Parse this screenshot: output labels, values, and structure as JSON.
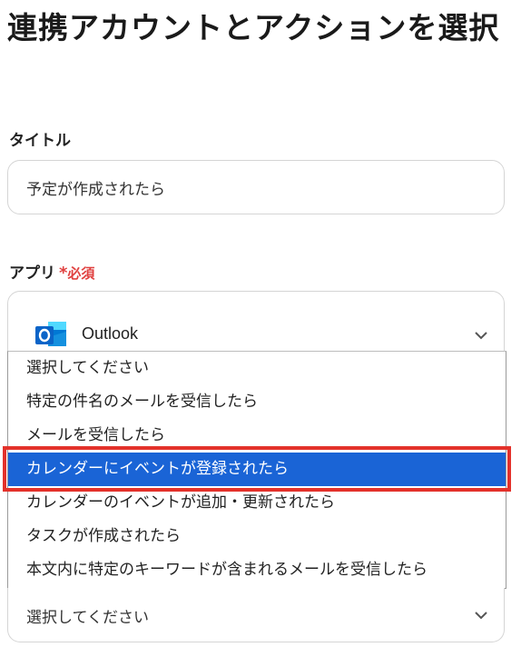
{
  "page": {
    "title": "連携アカウントとアクションを選択"
  },
  "title_field": {
    "label": "タイトル",
    "value": "予定が作成されたら"
  },
  "app_field": {
    "label": "アプリ",
    "required_mark": "*",
    "required_text": "必須",
    "selected_app": "Outlook",
    "icon": "outlook-logo"
  },
  "action_dropdown": {
    "options": [
      "選択してください",
      "特定の件名のメールを受信したら",
      "メールを受信したら",
      "カレンダーにイベントが登録されたら",
      "カレンダーのイベントが追加・更新されたら",
      "タスクが作成されたら",
      "本文内に特定のキーワードが含まれるメールを受信したら"
    ],
    "highlighted_index": 3
  },
  "action_select": {
    "value": "選択してください"
  },
  "colors": {
    "selection": "#1a64d6",
    "highlight_border": "#e3322b",
    "required": "#e0403f"
  }
}
